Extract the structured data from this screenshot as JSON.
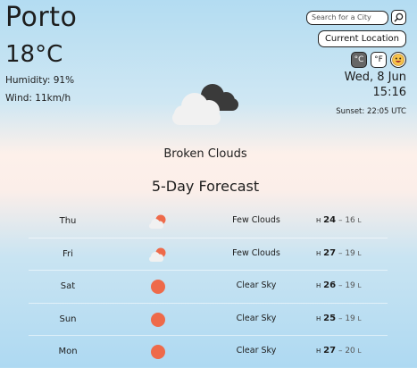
{
  "location": {
    "city": "Porto",
    "temperature": "18°C",
    "humidity": "Humidity: 91%",
    "wind": "Wind: 11km/h"
  },
  "controls": {
    "search_placeholder": "Search for a City",
    "current_location_label": "Current Location",
    "unit_c": "°C",
    "unit_f": "°F",
    "emoji_icon": "smiley-face-icon"
  },
  "datetime": {
    "date": "Wed, 8 Jun",
    "time": "15:16",
    "sunset": "Sunset: 22:05 UTC"
  },
  "current": {
    "icon": "broken-clouds-icon",
    "condition": "Broken Clouds"
  },
  "forecast": {
    "title": "5-Day Forecast",
    "h_label": "H",
    "l_label": "L",
    "days": [
      {
        "day": "Thu",
        "icon": "few-clouds-icon",
        "desc": "Few Clouds",
        "high": "24",
        "low": "16"
      },
      {
        "day": "Fri",
        "icon": "few-clouds-icon",
        "desc": "Few Clouds",
        "high": "27",
        "low": "19"
      },
      {
        "day": "Sat",
        "icon": "clear-sun-icon",
        "desc": "Clear Sky",
        "high": "26",
        "low": "19"
      },
      {
        "day": "Sun",
        "icon": "clear-sun-icon",
        "desc": "Clear Sky",
        "high": "25",
        "low": "19"
      },
      {
        "day": "Mon",
        "icon": "clear-sun-icon",
        "desc": "Clear Sky",
        "high": "27",
        "low": "20"
      }
    ]
  },
  "colors": {
    "sun": "#ee6a4a",
    "cloud_light": "#f2f2f2",
    "cloud_dark": "#3a3a3a"
  }
}
